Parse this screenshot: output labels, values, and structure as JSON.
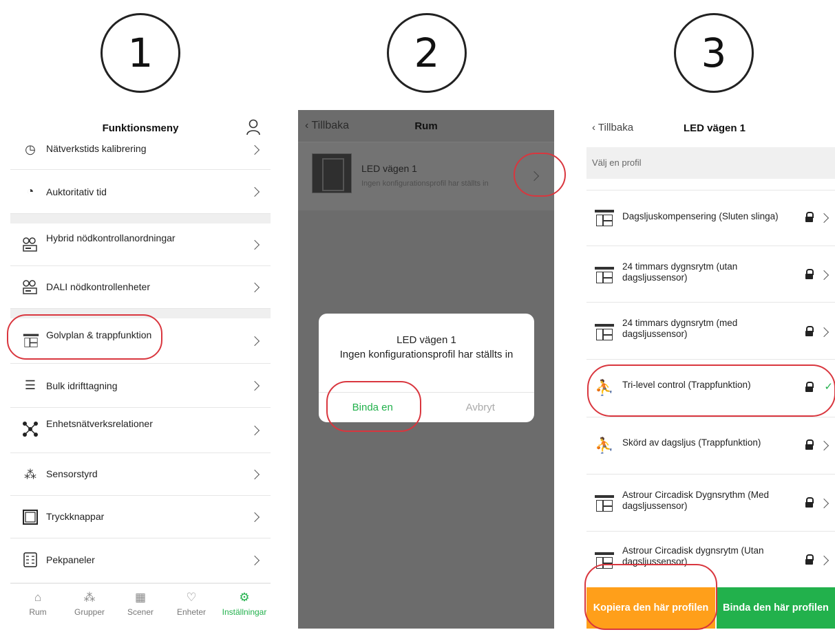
{
  "steps": [
    "1",
    "2",
    "3"
  ],
  "screen1": {
    "title": "Funktionsmeny",
    "items": [
      {
        "label": "Nätverkstids kalibrering",
        "icon": "clock-icon"
      },
      {
        "label": "Auktoritativ tid",
        "icon": "clock-plus-icon"
      },
      {
        "label": "Hybrid nödkontrollanordningar",
        "icon": "emergency-control-icon"
      },
      {
        "label": "DALI nödkontrollenheter",
        "icon": "emergency-control-icon"
      },
      {
        "label": "Golvplan & trappfunktion",
        "icon": "floorplan-icon"
      },
      {
        "label": "Bulk idrifttagning",
        "icon": "bulk-settings-icon"
      },
      {
        "label": "Enhetsnätverksrelationer",
        "icon": "network-icon"
      },
      {
        "label": "Sensorstyrd",
        "icon": "sensor-icon"
      },
      {
        "label": "Tryckknappar",
        "icon": "pushbutton-icon"
      },
      {
        "label": "Pekpaneler",
        "icon": "touchpanel-icon"
      }
    ],
    "tabs": [
      {
        "label": "Rum",
        "icon": "home-icon"
      },
      {
        "label": "Grupper",
        "icon": "groups-icon"
      },
      {
        "label": "Scener",
        "icon": "scenes-icon"
      },
      {
        "label": "Enheter",
        "icon": "bulb-icon"
      },
      {
        "label": "Inställningar",
        "icon": "settings-icon"
      }
    ]
  },
  "screen2": {
    "back": "Tillbaka",
    "title": "Rum",
    "room_name": "LED vägen 1",
    "room_status": "Ingen konfigurationsprofil har ställts in",
    "dialog": {
      "title": "LED vägen 1",
      "message": "Ingen konfigurationsprofil har ställts in",
      "confirm": "Binda en",
      "cancel": "Avbryt"
    }
  },
  "screen3": {
    "back": "Tillbaka",
    "title": "LED vägen 1",
    "hint": "Välj en profil",
    "profiles": [
      {
        "label": "Dagsljuskompensering (Sluten slinga)",
        "icon": "floorplan-icon"
      },
      {
        "label": "24 timmars dygnsrytm (utan dagsljussensor)",
        "icon": "floorplan-icon"
      },
      {
        "label": "24 timmars dygnsrytm (med dagsljussensor)",
        "icon": "floorplan-icon"
      },
      {
        "label": "Tri-level control (Trappfunktion)",
        "icon": "stairs-icon",
        "selected": true
      },
      {
        "label": "Skörd av dagsljus (Trappfunktion)",
        "icon": "stairs-icon"
      },
      {
        "label": "Astrour Circadisk Dygnsrythm (Med dagsljussensor)",
        "icon": "floorplan-icon"
      },
      {
        "label": "Astrour Circadisk dygnsrytm (Utan dagsljussensor)",
        "icon": "floorplan-icon"
      }
    ],
    "copy_button": "Kopiera den här profilen",
    "bind_button": "Binda den här profilen",
    "accent_green": "#22b14c",
    "accent_orange": "#ff9f1a",
    "highlight_red": "#d9363e"
  }
}
